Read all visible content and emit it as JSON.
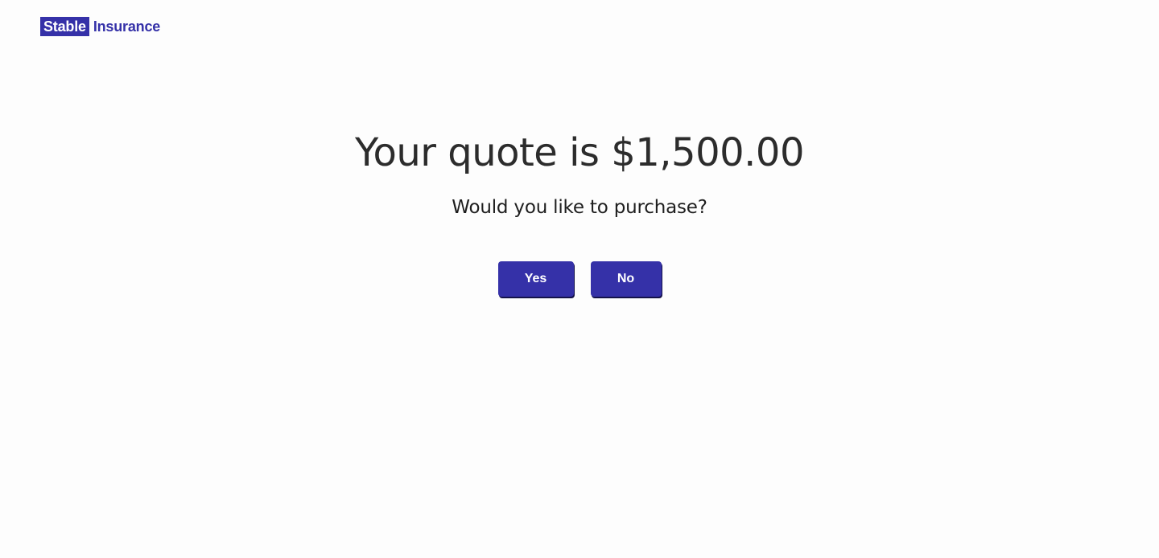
{
  "header": {
    "logo_box_text": "Stable",
    "logo_text": "Insurance"
  },
  "main": {
    "title": "Your quote is $1,500.00",
    "prompt": "Would you like to purchase?",
    "yes_label": "Yes",
    "no_label": "No"
  },
  "colors": {
    "brand": "#3531a8",
    "background": "#fdfdfd",
    "title_text": "#2c2c2c"
  }
}
